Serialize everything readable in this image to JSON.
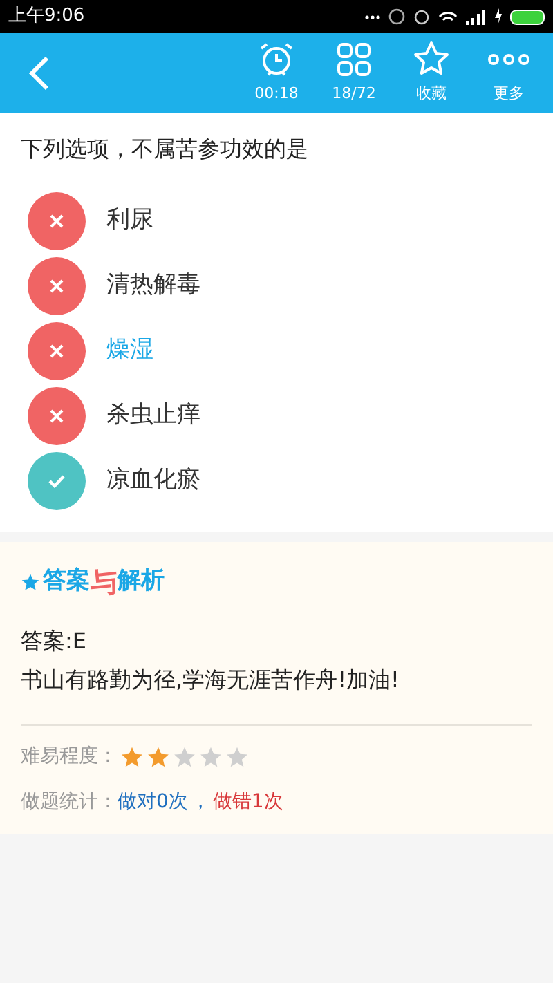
{
  "status_bar": {
    "time": "上午9:06"
  },
  "toolbar": {
    "items": [
      {
        "kind": "timer",
        "label": "00:18"
      },
      {
        "kind": "grid",
        "label": "18/72"
      },
      {
        "kind": "favorite",
        "label": "收藏"
      },
      {
        "kind": "more",
        "label": "更多"
      }
    ]
  },
  "question": "下列选项，不属苦参功效的是",
  "options": [
    {
      "text": "利尿",
      "kind": "wrong",
      "selected": false
    },
    {
      "text": "清热解毒",
      "kind": "wrong",
      "selected": false
    },
    {
      "text": "燥湿",
      "kind": "wrong",
      "selected": true
    },
    {
      "text": "杀虫止痒",
      "kind": "wrong",
      "selected": false
    },
    {
      "text": "凉血化瘀",
      "kind": "correct",
      "selected": false
    }
  ],
  "analysis": {
    "title_left": "答案",
    "title_joiner": "与",
    "title_right": "解析",
    "answer": "答案:E",
    "note": "书山有路勤为径,学海无涯苦作舟!加油!",
    "difficulty_label": "难易程度：",
    "stars": 2,
    "stats_label": "做题统计：",
    "stats_right": "做对0次",
    "stats_separator": "，",
    "stats_wrong": "做错1次"
  }
}
